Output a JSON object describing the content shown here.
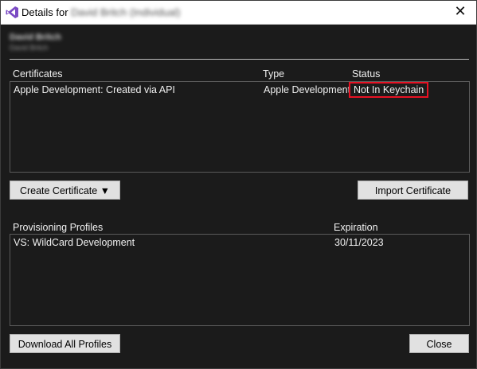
{
  "window": {
    "title_prefix": "Details for",
    "title_redacted": "David Britch (Individual)",
    "close_glyph": "✕"
  },
  "account": {
    "name": "David Britch",
    "team": "David Britch"
  },
  "certificates": {
    "headers": {
      "name": "Certificates",
      "type": "Type",
      "status": "Status"
    },
    "rows": [
      {
        "name": "Apple Development: Created via API",
        "type": "Apple Development",
        "status": "Not In Keychain"
      }
    ],
    "create_button": "Create Certificate ▼",
    "import_button": "Import Certificate"
  },
  "profiles": {
    "headers": {
      "name": "Provisioning Profiles",
      "expiration": "Expiration"
    },
    "rows": [
      {
        "name": "VS: WildCard Development",
        "expiration": "30/11/2023"
      }
    ],
    "download_button": "Download All Profiles",
    "close_button": "Close"
  },
  "colors": {
    "background": "#1b1b1b",
    "highlight_border": "#e81123",
    "button_face": "#e1e1e1"
  },
  "icons": {
    "app": "visual-studio-icon",
    "close": "close-icon"
  }
}
